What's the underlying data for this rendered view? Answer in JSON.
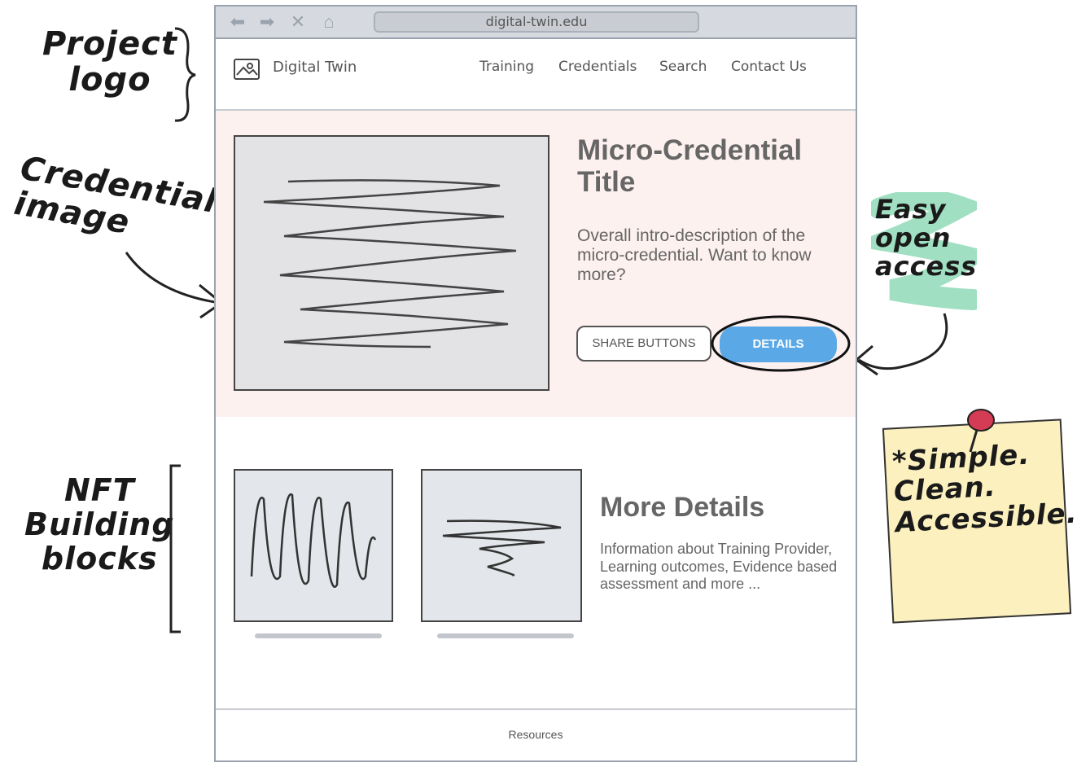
{
  "browser": {
    "url": "digital-twin.edu"
  },
  "header": {
    "logo_text": "Digital Twin",
    "nav": [
      "Training",
      "Credentials",
      "Search",
      "Contact Us"
    ]
  },
  "hero": {
    "title": "Micro-Credential Title",
    "description": "Overall intro-description of the micro-credential. Want to know more?",
    "share_label": "SHARE BUTTONS",
    "details_label": "DETAILS"
  },
  "more": {
    "title": "More Details",
    "description": "Information about Training Provider, Learning outcomes, Evidence based assessment and more ..."
  },
  "footer": {
    "label": "Resources"
  },
  "annotations": {
    "project_logo": "Project\nlogo",
    "credential_image": "Credential\nimage",
    "easy_open": "Easy\nopen\naccess",
    "nft_blocks": "NFT\nBuilding\nblocks",
    "sticky": "*Simple.\nClean.\nAccessible."
  },
  "colors": {
    "hero_bg": "#fdf1ef",
    "details_button": "#5aa8e6",
    "highlight_green": "#8fd9b6",
    "sticky_note": "#fbf0be",
    "pin": "#d43b55"
  },
  "icons": [
    "back-arrow-icon",
    "forward-arrow-icon",
    "close-icon",
    "home-icon",
    "image-icon",
    "pushpin-icon"
  ]
}
